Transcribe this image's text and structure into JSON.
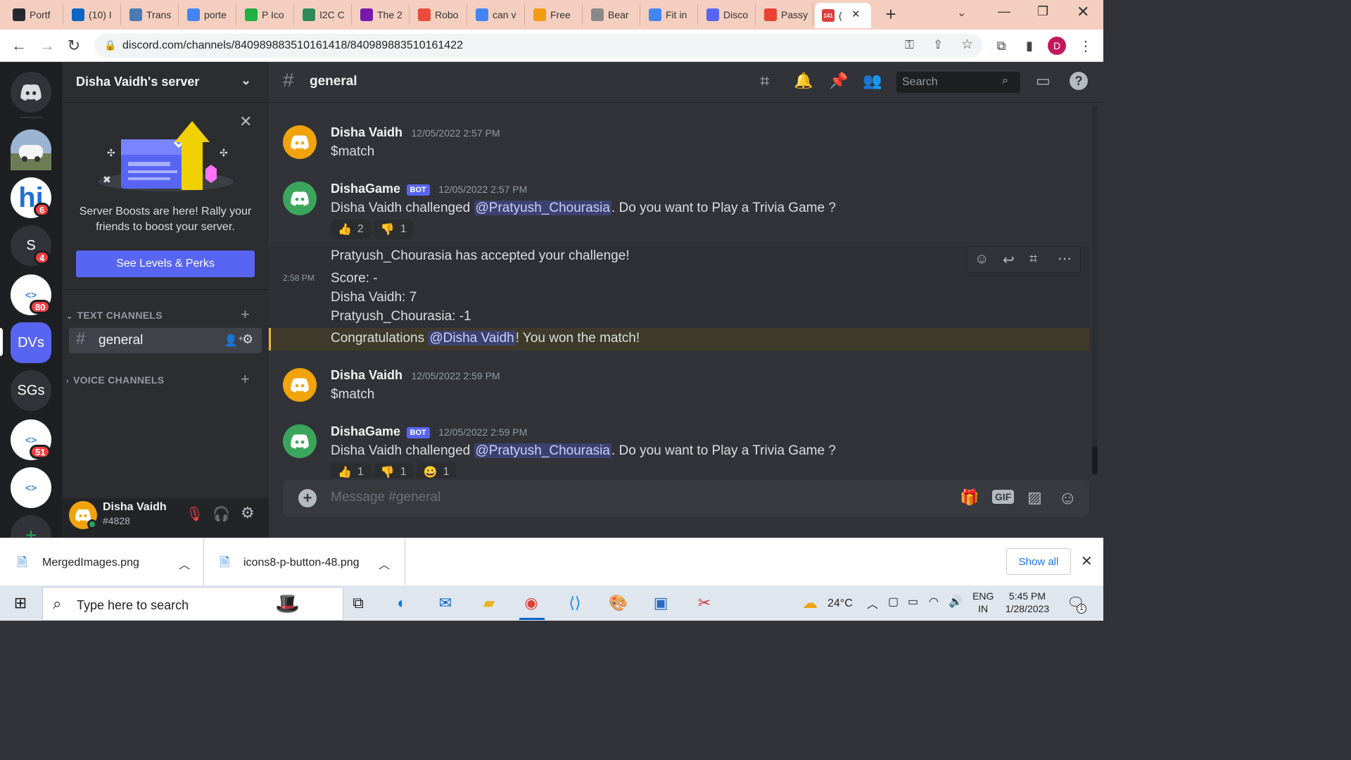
{
  "browser": {
    "tabs": [
      {
        "label": "Portf",
        "icon": "portfolio-icon",
        "color": "#24292f"
      },
      {
        "label": "(10) I",
        "icon": "linkedin-icon",
        "color": "#0a66c2"
      },
      {
        "label": "Trans",
        "icon": "translate-icon",
        "color": "#4a7bb7"
      },
      {
        "label": "porte",
        "icon": "google-icon",
        "color": "#4285f4"
      },
      {
        "label": "P Ico",
        "icon": "icons8-icon",
        "color": "#1fb141"
      },
      {
        "label": "I2C C",
        "icon": "i2c-icon",
        "color": "#2e8b57"
      },
      {
        "label": "The 2",
        "icon": "onenote-icon",
        "color": "#7719aa"
      },
      {
        "label": "Robo",
        "icon": "robo-icon",
        "color": "#e74c3c"
      },
      {
        "label": "can v",
        "icon": "google-icon",
        "color": "#4285f4"
      },
      {
        "label": "Free",
        "icon": "free-icon",
        "color": "#f39c12"
      },
      {
        "label": "Bear",
        "icon": "bear-icon",
        "color": "#888888"
      },
      {
        "label": "Fit in",
        "icon": "google-icon",
        "color": "#4285f4"
      },
      {
        "label": "Disco",
        "icon": "discord-icon",
        "color": "#5865f2"
      },
      {
        "label": "Passy",
        "icon": "gmail-icon",
        "color": "#ea4335"
      },
      {
        "label": "(",
        "icon": "discord-notify-icon",
        "color": "#e03c3c",
        "badge": "141"
      }
    ],
    "url": "discord.com/channels/840989883510161418/840989883510161422",
    "profile_initial": "D"
  },
  "guilds": [
    {
      "label": "",
      "icon": "discord-home-icon",
      "color": "#313338"
    },
    {
      "label": "",
      "icon": "car-avatar",
      "color": "#8fa8c8"
    },
    {
      "label": "hi",
      "icon": "hi-server",
      "color": "#ffffff",
      "badge": "6"
    },
    {
      "label": "S",
      "icon": "s-server",
      "color": "#313338",
      "badge": "4"
    },
    {
      "label": "",
      "icon": "dev-club-server",
      "color": "#ffffff",
      "badge": "80"
    },
    {
      "label": "DVs",
      "icon": "dvs-server",
      "color": "#5865f2"
    },
    {
      "label": "SGs",
      "icon": "sgs-server",
      "color": "#313338"
    },
    {
      "label": "",
      "icon": "codechef-server",
      "color": "#ffffff",
      "badge": "51"
    },
    {
      "label": "",
      "icon": "dev-club-server-2",
      "color": "#ffffff"
    }
  ],
  "server": {
    "name": "Disha Vaidh's server",
    "boost_text": "Server Boosts are here! Rally your friends to boost your server.",
    "boost_button": "See Levels & Perks",
    "text_channels_label": "TEXT CHANNELS",
    "voice_channels_label": "VOICE CHANNELS",
    "active_channel": "general"
  },
  "user": {
    "name": "Disha Vaidh",
    "tag": "#4828"
  },
  "channel": {
    "name": "general",
    "search_placeholder": "Search",
    "composer_placeholder": "Message #general"
  },
  "messages": [
    {
      "author": "Disha Vaidh",
      "time": "12/05/2022 2:57 PM",
      "text": "$match"
    },
    {
      "author": "DishaGame",
      "bot_tag": "BOT",
      "time": "12/05/2022 2:57 PM",
      "text_pre": "Disha Vaidh challenged ",
      "mention": "@Pratyush_Chourasia",
      "text_post": ". Do you want to Play a Trivia Game ?",
      "reactions": [
        {
          "emoji": "👍",
          "count": "2"
        },
        {
          "emoji": "👎",
          "count": "1"
        }
      ]
    },
    {
      "text": "Pratyush_Chourasia has accepted your challenge!"
    },
    {
      "time_short": "2:58 PM",
      "lines": [
        "Score: -",
        "Disha Vaidh: 7",
        "Pratyush_Chourasia: -1"
      ]
    },
    {
      "text_pre": "Congratulations ",
      "mention": "@Disha Vaidh",
      "text_post": "! You won the match!"
    },
    {
      "author": "Disha Vaidh",
      "time": "12/05/2022 2:59 PM",
      "text": "$match"
    },
    {
      "author": "DishaGame",
      "bot_tag": "BOT",
      "time": "12/05/2022 2:59 PM",
      "text_pre": "Disha Vaidh challenged ",
      "mention": "@Pratyush_Chourasia",
      "text_post": ". Do you want to Play a Trivia Game ?",
      "reactions": [
        {
          "emoji": "👍",
          "count": "1"
        },
        {
          "emoji": "👎",
          "count": "1"
        },
        {
          "emoji": "😀",
          "count": "1"
        }
      ]
    }
  ],
  "downloads": [
    {
      "name": "MergedImages.png"
    },
    {
      "name": "icons8-p-button-48.png"
    }
  ],
  "downloads_show_all": "Show all",
  "taskbar": {
    "search_placeholder": "Type here to search",
    "temperature": "24°C",
    "lang_1": "ENG",
    "lang_2": "IN",
    "time": "5:45 PM",
    "date": "1/28/2023",
    "notif_count": "1"
  },
  "colors": {
    "discord_blurple": "#5865f2",
    "bot_green": "#3ba55c",
    "user_orange": "#f0a30a",
    "highlight_row": "#3f3a2a"
  }
}
